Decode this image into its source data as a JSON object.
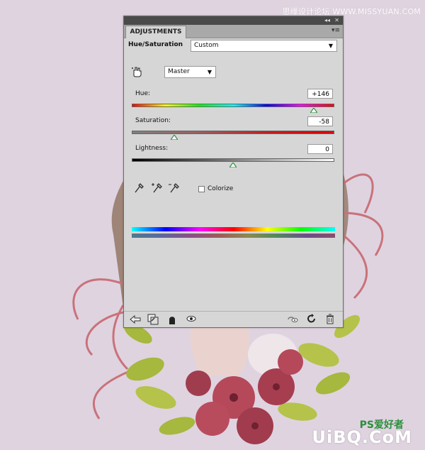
{
  "watermark": {
    "top_text": "思缘设计论坛 WWW.MISSYUAN.COM",
    "bottom_text": "UiBQ.CoM",
    "ps_text": "PS爱好者"
  },
  "panel": {
    "tab_label": "ADJUSTMENTS",
    "menu_symbol": "▾≡",
    "title": "Hue/Saturation",
    "preset": {
      "value": "Custom"
    },
    "channel": {
      "value": "Master"
    },
    "hue": {
      "label": "Hue:",
      "value": "+146",
      "level": 0.9
    },
    "saturation": {
      "label": "Saturation:",
      "value": "-58",
      "level": 0.21
    },
    "lightness": {
      "label": "Lightness:",
      "value": "0",
      "level": 0.5
    },
    "colorize": {
      "label": "Colorize",
      "checked": false
    }
  },
  "colors": {
    "panel_bg": "#d6d6d6",
    "background": "#dfd3e0",
    "thumb": "#2e8f3b"
  }
}
